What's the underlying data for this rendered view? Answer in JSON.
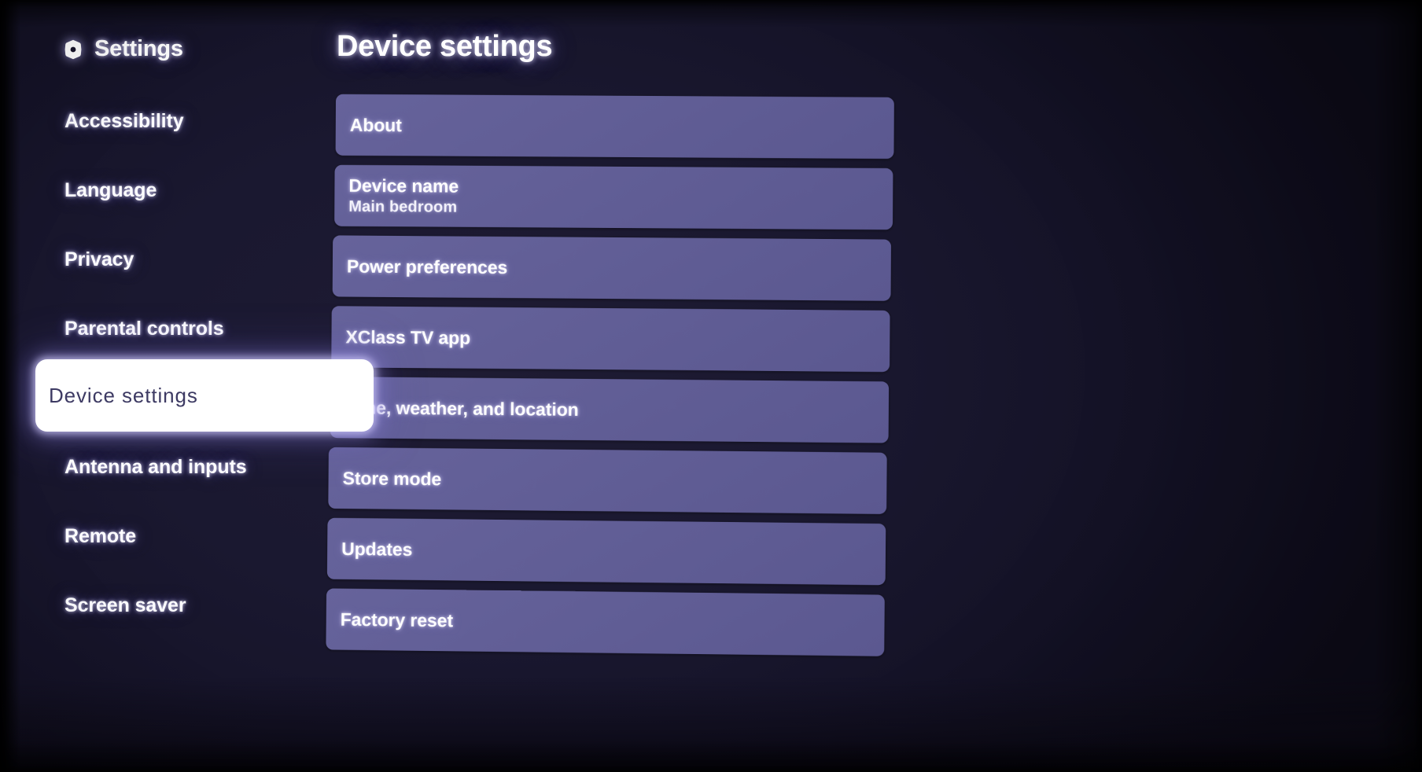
{
  "sidebar": {
    "header": {
      "icon": "gear-icon",
      "title": "Settings"
    },
    "items": [
      {
        "label": "Accessibility",
        "selected": false
      },
      {
        "label": "Language",
        "selected": false
      },
      {
        "label": "Privacy",
        "selected": false
      },
      {
        "label": "Parental controls",
        "selected": false
      },
      {
        "label": "Device settings",
        "selected": true
      },
      {
        "label": "Antenna and inputs",
        "selected": false
      },
      {
        "label": "Remote",
        "selected": false
      },
      {
        "label": "Screen saver",
        "selected": false
      }
    ]
  },
  "main": {
    "title": "Device settings",
    "rows": [
      {
        "title": "About",
        "sub": ""
      },
      {
        "title": "Device name",
        "sub": "Main bedroom"
      },
      {
        "title": "Power preferences",
        "sub": ""
      },
      {
        "title": "XClass TV app",
        "sub": ""
      },
      {
        "title": "Time, weather, and location",
        "sub": ""
      },
      {
        "title": "Store mode",
        "sub": ""
      },
      {
        "title": "Updates",
        "sub": ""
      },
      {
        "title": "Factory reset",
        "sub": ""
      }
    ]
  },
  "colors": {
    "background": "#1a1830",
    "row_fill": "#615e96",
    "selected_pill": "#ffffff",
    "selected_text": "#3d3a63",
    "text": "#ffffff"
  }
}
